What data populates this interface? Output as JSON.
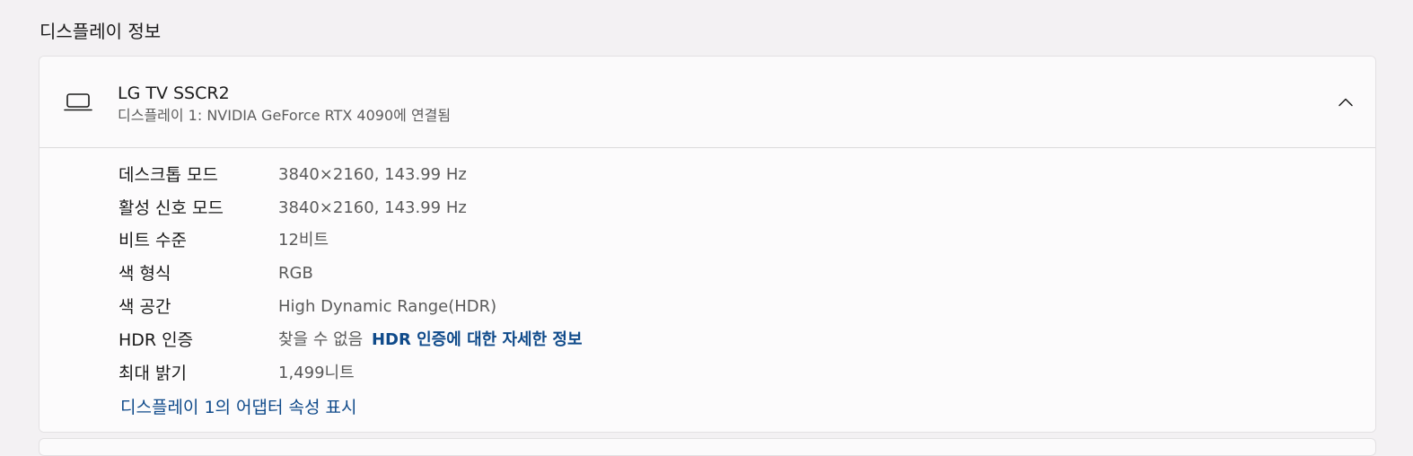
{
  "section": {
    "title": "디스플레이 정보"
  },
  "display": {
    "name": "LG TV SSCR2",
    "subtitle": "디스플레이 1: NVIDIA GeForce RTX 4090에 연결됨",
    "icon": "laptop-icon",
    "expanded": true,
    "collapse_icon": "chevron-up-icon"
  },
  "properties": [
    {
      "label": "데스크톱 모드",
      "value": "3840×2160, 143.99 Hz"
    },
    {
      "label": "활성 신호 모드",
      "value": "3840×2160, 143.99 Hz"
    },
    {
      "label": "비트 수준",
      "value": "12비트"
    },
    {
      "label": "색 형식",
      "value": "RGB"
    },
    {
      "label": "색 공간",
      "value": "High Dynamic Range(HDR)"
    },
    {
      "label": "HDR 인증",
      "value": "찾을 수 없음",
      "link": "HDR 인증에 대한 자세한 정보"
    },
    {
      "label": "최대 밝기",
      "value": "1,499니트"
    }
  ],
  "adapter_link": "디스플레이 1의 어댑터 속성 표시",
  "colors": {
    "link": "#0f4a8a",
    "background": "#f3f1f3",
    "card": "#fbfafb"
  }
}
